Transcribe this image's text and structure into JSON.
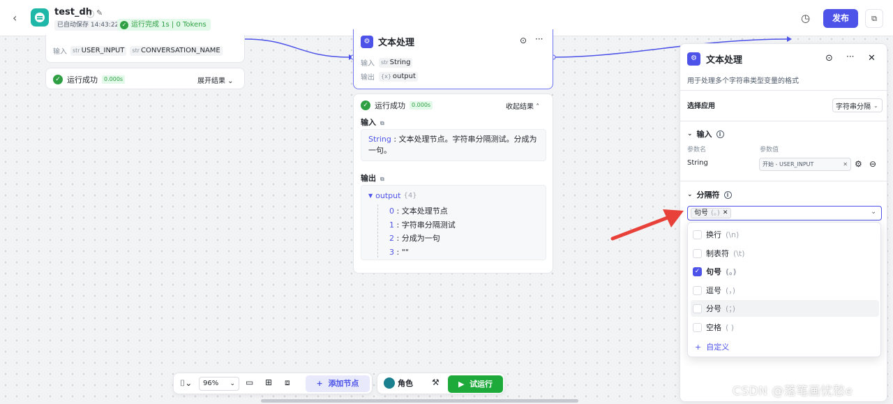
{
  "header": {
    "title": "test_dh",
    "autosave": "已自动保存 14:43:22",
    "run_status": "运行完成 1s | 0 Tokens",
    "publish_label": "发布"
  },
  "node_start": {
    "input_label": "输入",
    "params": [
      {
        "type": "str",
        "name": "USER_INPUT"
      },
      {
        "type": "str",
        "name": "CONVERSATION_NAME"
      }
    ],
    "result_status": "运行成功",
    "result_time": "0.000s",
    "expand_label": "展开结果"
  },
  "node_text": {
    "title": "文本处理",
    "input_label": "输入",
    "input_type": "str",
    "input_value": "String",
    "output_label": "输出",
    "output_type": "{x}",
    "output_value": "output",
    "result_status": "运行成功",
    "result_time": "0.000s",
    "collapse_label": "收起结果",
    "section_input": "输入",
    "input_key": "String",
    "input_text": "文本处理节点。字符串分隔测试。分成为一句。",
    "section_output": "输出",
    "output_key": "output",
    "output_count": "{4}",
    "output_items": [
      {
        "index": "0",
        "value": "文本处理节点"
      },
      {
        "index": "1",
        "value": "字符串分隔测试"
      },
      {
        "index": "2",
        "value": "分成为一句"
      },
      {
        "index": "3",
        "value": "\"\""
      }
    ]
  },
  "panel": {
    "title": "文本处理",
    "description": "用于处理多个字符串类型变量的格式",
    "select_app_label": "选择应用",
    "select_app_value": "字符串分隔",
    "input_section": "输入",
    "param_name_header": "参数名",
    "param_value_header": "参数值",
    "param_name": "String",
    "param_value": "开始 - USER_INPUT",
    "separator_section": "分隔符",
    "selected_chip": "句号",
    "selected_chip_sym": "(。)",
    "options": [
      {
        "label": "换行",
        "sym": "(\\n)",
        "checked": false
      },
      {
        "label": "制表符",
        "sym": "(\\t)",
        "checked": false
      },
      {
        "label": "句号",
        "sym": "(。)",
        "checked": true
      },
      {
        "label": "逗号",
        "sym": "(，)",
        "checked": false
      },
      {
        "label": "分号",
        "sym": "(；)",
        "checked": false
      },
      {
        "label": "空格",
        "sym": "( )",
        "checked": false
      }
    ],
    "custom_label": "自定义"
  },
  "toolbar": {
    "zoom": "96%",
    "add_node": "添加节点",
    "role": "角色",
    "test_run": "试运行"
  },
  "watermark": "CSDN @落笔画忧愁e",
  "colors": {
    "accent": "#4d53e8",
    "success": "#2ea043",
    "run_button": "#1daa3a",
    "arrow": "#e8413a"
  }
}
